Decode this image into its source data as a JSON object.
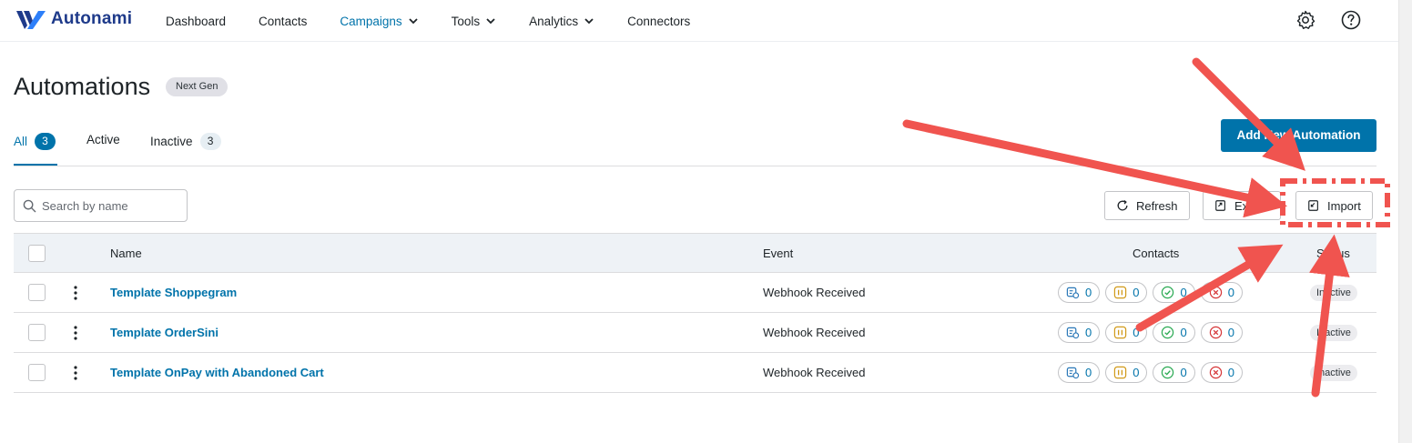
{
  "app": {
    "brand": "Autonami",
    "accent": "#0073aa"
  },
  "nav": {
    "items": [
      {
        "label": "Dashboard"
      },
      {
        "label": "Contacts"
      },
      {
        "label": "Campaigns"
      },
      {
        "label": "Tools"
      },
      {
        "label": "Analytics"
      },
      {
        "label": "Connectors"
      }
    ],
    "icons": [
      "gear-icon",
      "help-icon"
    ]
  },
  "header": {
    "title": "Automations",
    "badge": "Next Gen"
  },
  "tabs": [
    {
      "label": "All",
      "count": "3"
    },
    {
      "label": "Active"
    },
    {
      "label": "Inactive",
      "count": "3"
    }
  ],
  "actions": {
    "add": "Add New Automation",
    "refresh": "Refresh",
    "export": "Export",
    "import": "Import"
  },
  "search": {
    "placeholder": "Search by name",
    "value": ""
  },
  "table": {
    "headers": {
      "name": "Name",
      "event": "Event",
      "contacts": "Contacts",
      "status": "Status"
    },
    "rows": [
      {
        "name": "Template Shoppegram",
        "event": "Webhook Received",
        "queued": "0",
        "paused": "0",
        "completed": "0",
        "failed": "0",
        "status": "Inactive"
      },
      {
        "name": "Template OrderSini",
        "event": "Webhook Received",
        "queued": "0",
        "paused": "0",
        "completed": "0",
        "failed": "0",
        "status": "Inactive"
      },
      {
        "name": "Template OnPay with Abandoned Cart",
        "event": "Webhook Received",
        "queued": "0",
        "paused": "0",
        "completed": "0",
        "failed": "0",
        "status": "Inactive"
      }
    ]
  },
  "annotation": {
    "color": "#f0544f"
  }
}
